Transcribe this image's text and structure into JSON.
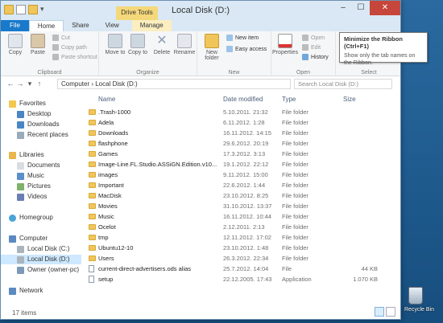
{
  "window": {
    "title": "Local Disk (D:)",
    "context_tab_group": "Drive Tools",
    "controls": {
      "minimize": "–",
      "maximize": "☐",
      "close": "✕"
    }
  },
  "ribbon_tabs": [
    "File",
    "Home",
    "Share",
    "View",
    "Manage"
  ],
  "ribbon": {
    "clipboard": {
      "label": "Clipboard",
      "copy": "Copy",
      "paste": "Paste",
      "cut": "Cut",
      "copy_path": "Copy path",
      "paste_shortcut": "Paste shortcut"
    },
    "organize": {
      "label": "Organize",
      "move_to": "Move to",
      "copy_to": "Copy to",
      "delete": "Delete",
      "rename": "Rename"
    },
    "new": {
      "label": "New",
      "new_folder": "New folder",
      "new_item": "New item",
      "easy_access": "Easy access"
    },
    "open": {
      "label": "Open",
      "properties": "Properties",
      "open": "Open",
      "edit": "Edit",
      "history": "History"
    },
    "select": {
      "label": "Select"
    }
  },
  "tooltip": {
    "title": "Minimize the Ribbon (Ctrl+F1)",
    "body": "Show only the tab names on the Ribbon."
  },
  "address": {
    "path": "Computer  ›  Local Disk (D:)",
    "search_placeholder": "Search Local Disk (D:)"
  },
  "nav": {
    "favorites": "Favorites",
    "desktop": "Desktop",
    "downloads": "Downloads",
    "recent": "Recent places",
    "libraries": "Libraries",
    "documents": "Documents",
    "music": "Music",
    "pictures": "Pictures",
    "videos": "Videos",
    "homegroup": "Homegroup",
    "computer": "Computer",
    "local_c": "Local Disk (C:)",
    "local_d": "Local Disk (D:)",
    "owner": "Owner (owner-pc)",
    "network": "Network"
  },
  "columns": {
    "name": "Name",
    "date": "Date modified",
    "type": "Type",
    "size": "Size"
  },
  "files": [
    {
      "name": ".Trash-1000",
      "date": "5.10.2011. 21:32",
      "type": "File folder",
      "size": "",
      "kind": "folder"
    },
    {
      "name": "Adela",
      "date": "6.11.2012. 1:28",
      "type": "File folder",
      "size": "",
      "kind": "folder"
    },
    {
      "name": "Downloads",
      "date": "16.11.2012. 14:15",
      "type": "File folder",
      "size": "",
      "kind": "folder"
    },
    {
      "name": "flashphone",
      "date": "29.6.2012. 20:19",
      "type": "File folder",
      "size": "",
      "kind": "folder"
    },
    {
      "name": "Games",
      "date": "17.3.2012. 3:13",
      "type": "File folder",
      "size": "",
      "kind": "folder"
    },
    {
      "name": "Image-Line.FL.Studio.ASSiGN.Edition.v10...",
      "date": "19.1.2012. 22:12",
      "type": "File folder",
      "size": "",
      "kind": "folder"
    },
    {
      "name": "images",
      "date": "9.11.2012. 15:00",
      "type": "File folder",
      "size": "",
      "kind": "folder"
    },
    {
      "name": "Important",
      "date": "22.6.2012. 1:44",
      "type": "File folder",
      "size": "",
      "kind": "folder"
    },
    {
      "name": "MacDisk",
      "date": "23.10.2012. 8:25",
      "type": "File folder",
      "size": "",
      "kind": "folder"
    },
    {
      "name": "Movies",
      "date": "31.10.2012. 13:37",
      "type": "File folder",
      "size": "",
      "kind": "folder"
    },
    {
      "name": "Music",
      "date": "16.11.2012. 10:44",
      "type": "File folder",
      "size": "",
      "kind": "folder"
    },
    {
      "name": "Ocelot",
      "date": "2.12.2011. 2:13",
      "type": "File folder",
      "size": "",
      "kind": "folder"
    },
    {
      "name": "tmp",
      "date": "12.11.2012. 17:02",
      "type": "File folder",
      "size": "",
      "kind": "folder"
    },
    {
      "name": "Ubuntu12-10",
      "date": "23.10.2012. 1:48",
      "type": "File folder",
      "size": "",
      "kind": "folder"
    },
    {
      "name": "Users",
      "date": "26.3.2012. 22:34",
      "type": "File folder",
      "size": "",
      "kind": "folder"
    },
    {
      "name": "current-direct-advertisers.ods alias",
      "date": "25.7.2012. 14:04",
      "type": "File",
      "size": "44 KB",
      "kind": "file"
    },
    {
      "name": "setup",
      "date": "22.12.2005. 17:43",
      "type": "Application",
      "size": "1.070 KB",
      "kind": "file"
    }
  ],
  "status": {
    "count": "17 items"
  },
  "desktop": {
    "recycle_bin": "Recycle Bin"
  }
}
